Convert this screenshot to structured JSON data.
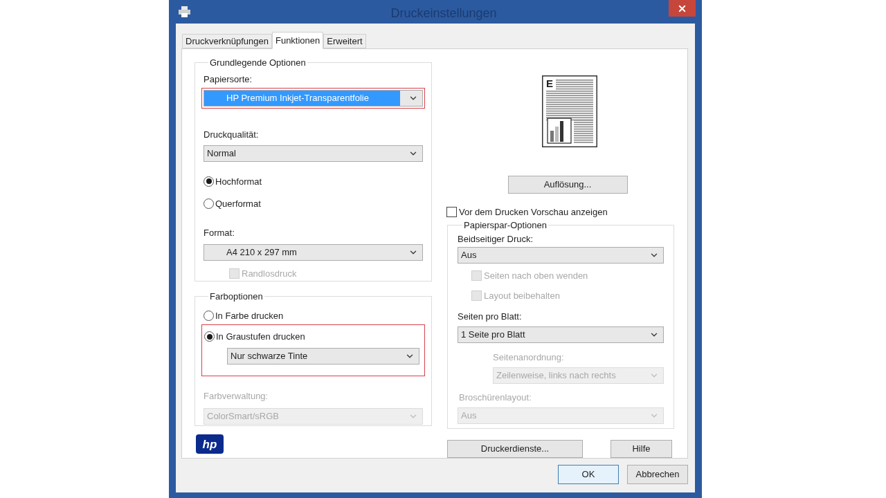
{
  "window": {
    "title": "Druckeinstellungen"
  },
  "tabs": [
    {
      "label": "Druckverknüpfungen",
      "selected": false
    },
    {
      "label": "Funktionen",
      "selected": true
    },
    {
      "label": "Erweitert",
      "selected": false
    }
  ],
  "basic_options": {
    "legend": "Grundlegende Optionen",
    "paper_type": {
      "label": "Papiersorte:",
      "value": "HP Premium Inkjet-Transparentfolie",
      "focused": true,
      "highlighted": true
    },
    "quality": {
      "label": "Druckqualität:",
      "value": "Normal"
    },
    "orientation": [
      {
        "label": "Hochformat",
        "selected": true
      },
      {
        "label": "Querformat",
        "selected": false
      }
    ],
    "format": {
      "label": "Format:",
      "value": "A4 210 x 297 mm"
    },
    "borderless": {
      "label": "Randlosdruck",
      "checked": false,
      "disabled": true
    }
  },
  "color_options": {
    "legend": "Farboptionen",
    "highlighted": true,
    "modes": [
      {
        "label": "In Farbe drucken",
        "selected": false
      },
      {
        "label": "In Graustufen drucken",
        "selected": true
      }
    ],
    "grayscale": {
      "value": "Nur schwarze Tinte"
    },
    "management": {
      "label": "Farbverwaltung:",
      "value": "ColorSmart/sRGB",
      "disabled": true
    }
  },
  "logo": "hp",
  "preview": {
    "letter": "E"
  },
  "resolution_button": "Auflösung...",
  "preview_checkbox": {
    "label": "Vor dem Drucken Vorschau anzeigen",
    "checked": false
  },
  "paper_saving": {
    "legend": "Papierspar-Optionen",
    "duplex": {
      "label": "Beidseitiger Druck:",
      "value": "Aus"
    },
    "checkboxes": [
      {
        "label": "Seiten nach oben wenden",
        "checked": false,
        "disabled": true
      },
      {
        "label": "Layout beibehalten",
        "checked": false,
        "disabled": true
      }
    ],
    "pages_per_sheet": {
      "label": "Seiten pro Blatt:",
      "value": "1 Seite pro Blatt"
    },
    "page_order": {
      "label": "Seitenanordnung:",
      "value": "Zeilenweise, links nach rechts",
      "disabled": true
    },
    "booklet": {
      "label": "Broschürenlayout:",
      "value": "Aus",
      "disabled": true
    }
  },
  "printer_services_button": "Druckerdienste...",
  "help_button": "Hilfe",
  "footer_buttons": [
    {
      "label": "OK",
      "default": true
    },
    {
      "label": "Abbrechen",
      "default": false
    }
  ]
}
